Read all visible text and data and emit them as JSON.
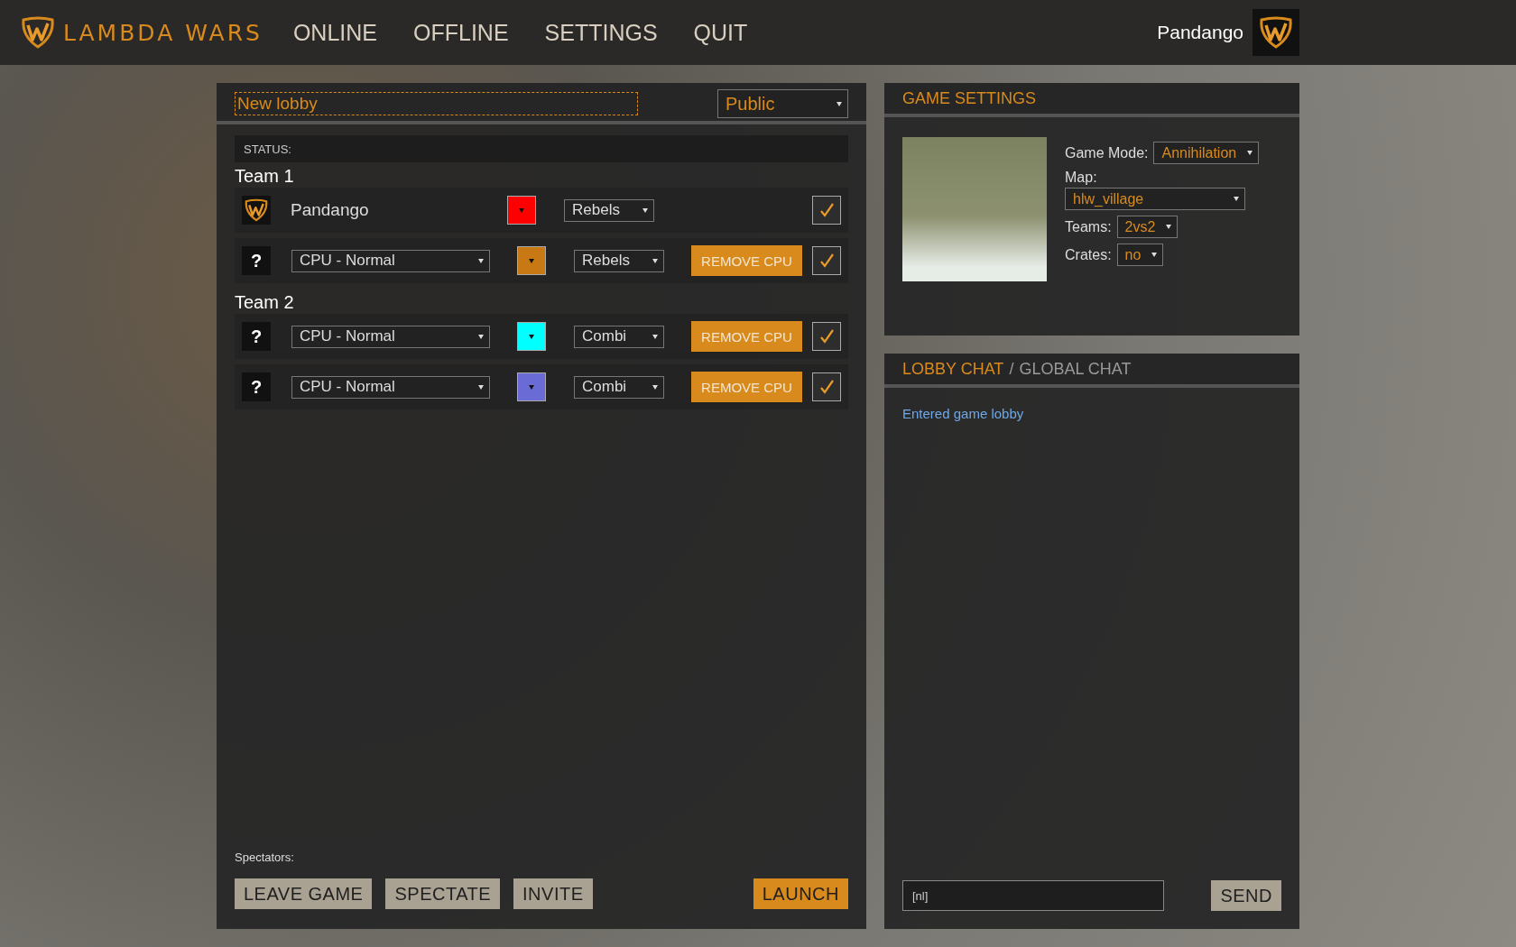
{
  "top_bar": {
    "logo_text": "LAMBDA WARS",
    "menu": [
      {
        "label": "ONLINE"
      },
      {
        "label": "OFFLINE"
      },
      {
        "label": "SETTINGS"
      },
      {
        "label": "QUIT"
      }
    ],
    "user_name": "Pandango"
  },
  "lobby": {
    "name": "New lobby",
    "visibility": "Public",
    "status_label": "STATUS:",
    "teams": [
      {
        "name": "Team 1",
        "players": [
          {
            "kind": "human",
            "name": "Pandango",
            "color": "#ff0000",
            "faction": "Rebels",
            "ready": true
          },
          {
            "kind": "cpu",
            "avatar": "?",
            "difficulty": "CPU - Normal",
            "color": "#c87914",
            "faction": "Rebels",
            "remove": "REMOVE CPU",
            "ready": true
          }
        ]
      },
      {
        "name": "Team 2",
        "players": [
          {
            "kind": "cpu",
            "avatar": "?",
            "difficulty": "CPU - Normal",
            "color": "#00ffff",
            "faction": "Combi",
            "remove": "REMOVE CPU",
            "ready": true
          },
          {
            "kind": "cpu",
            "avatar": "?",
            "difficulty": "CPU - Normal",
            "color": "#6b6bd6",
            "faction": "Combi",
            "remove": "REMOVE CPU",
            "ready": true
          }
        ]
      }
    ],
    "spectators_label": "Spectators:",
    "buttons": [
      {
        "label": "LEAVE GAME",
        "kind": "plain"
      },
      {
        "label": "SPECTATE",
        "kind": "plain"
      },
      {
        "label": "INVITE",
        "kind": "plain"
      },
      {
        "label": "LAUNCH",
        "kind": "primary"
      }
    ]
  },
  "game_settings": {
    "title": "GAME SETTINGS",
    "fields": [
      {
        "label": "Game Mode:",
        "value": "Annihilation",
        "kind": "inline"
      },
      {
        "label": "Map:",
        "value": "hlw_village",
        "kind": "stacked"
      },
      {
        "label": "Teams:",
        "value": "2vs2",
        "kind": "inline"
      },
      {
        "label": "Crates:",
        "value": "no",
        "kind": "inline"
      }
    ]
  },
  "chat": {
    "tabs": [
      {
        "label": "LOBBY CHAT",
        "selected": true
      },
      {
        "label": "GLOBAL CHAT",
        "selected": false
      }
    ],
    "separator": "/",
    "messages": [
      "Entered game lobby"
    ],
    "input_value": "[nl]",
    "send": "SEND"
  }
}
